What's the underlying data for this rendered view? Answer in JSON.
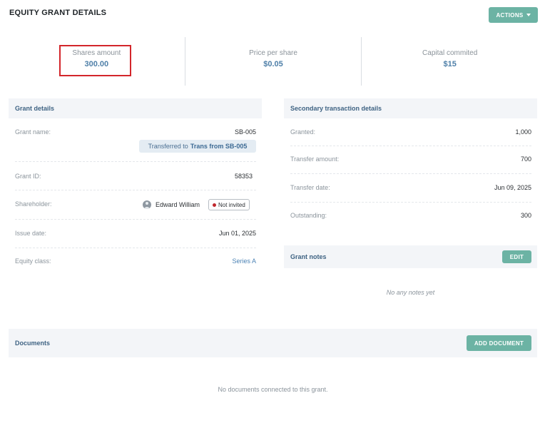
{
  "header": {
    "title": "EQUITY GRANT DETAILS",
    "actions_label": "ACTIONS"
  },
  "summary": [
    {
      "label": "Shares amount",
      "value": "300.00"
    },
    {
      "label": "Price per share",
      "value": "$0.05"
    },
    {
      "label": "Capital commited",
      "value": "$15"
    }
  ],
  "grant_details": {
    "title": "Grant details",
    "grant_name_label": "Grant name:",
    "grant_name_value": "SB-005",
    "transfer_prefix": "Transferred to",
    "transfer_link": "Trans from SB-005",
    "grant_id_label": "Grant ID:",
    "grant_id_value": "58353",
    "shareholder_label": "Shareholder:",
    "shareholder_name": "Edward William",
    "shareholder_status": "Not invited",
    "issue_date_label": "Issue date:",
    "issue_date_value": "Jun 01, 2025",
    "equity_class_label": "Equity class:",
    "equity_class_value": "Series A"
  },
  "secondary": {
    "title": "Secondary transaction details",
    "granted_label": "Granted:",
    "granted_value": "1,000",
    "transfer_amount_label": "Transfer amount:",
    "transfer_amount_value": "700",
    "transfer_date_label": "Transfer date:",
    "transfer_date_value": "Jun 09, 2025",
    "outstanding_label": "Outstanding:",
    "outstanding_value": "300"
  },
  "grant_notes": {
    "title": "Grant notes",
    "edit_label": "EDIT",
    "empty_text": "No any notes yet"
  },
  "documents": {
    "title": "Documents",
    "add_label": "ADD DOCUMENT",
    "empty_text": "No documents connected to this grant."
  },
  "colors": {
    "accent": "#6cb3a4",
    "link": "#4b82b5",
    "highlight": "#d3262b",
    "status_dot": "#c0282e"
  }
}
